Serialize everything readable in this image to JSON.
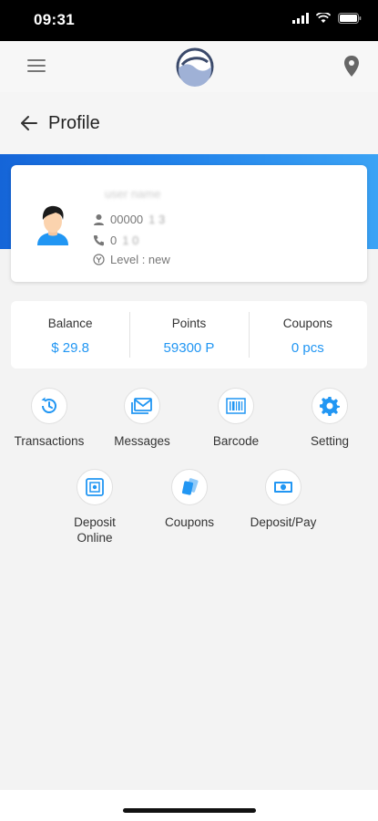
{
  "status_bar": {
    "time": "09:31"
  },
  "header": {
    "menu_icon": "hamburger-menu-icon",
    "logo_icon": "wave-logo-icon",
    "location_icon": "location-pin-icon"
  },
  "title_bar": {
    "title": "Profile",
    "back_icon": "back-arrow-icon"
  },
  "profile": {
    "name": "user name",
    "member_id": "00000",
    "member_id_rest": "1 3",
    "phone": "0",
    "phone_rest": "1 0",
    "level": "Level : new"
  },
  "stats": [
    {
      "label": "Balance",
      "value": "$ 29.8"
    },
    {
      "label": "Points",
      "value": "59300 P"
    },
    {
      "label": "Coupons",
      "value": "0 pcs"
    }
  ],
  "actions_row1": [
    {
      "label": "Transactions",
      "icon": "history-icon"
    },
    {
      "label": "Messages",
      "icon": "mail-icon"
    },
    {
      "label": "Barcode",
      "icon": "barcode-icon"
    },
    {
      "label": "Setting",
      "icon": "gear-icon"
    }
  ],
  "actions_row2": [
    {
      "label": "Deposit\nOnline",
      "icon": "safe-icon"
    },
    {
      "label": "Coupons",
      "icon": "coupon-icon"
    },
    {
      "label": "Deposit/Pay",
      "icon": "cash-icon"
    }
  ],
  "colors": {
    "accent": "#2196f3",
    "band": "#1e7ee8"
  }
}
